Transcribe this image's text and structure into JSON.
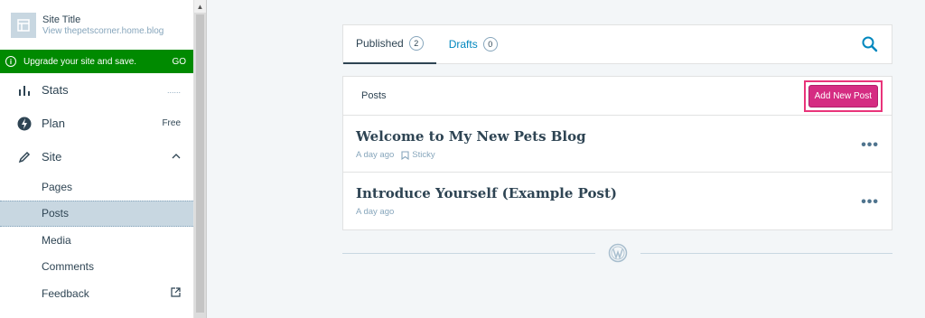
{
  "site": {
    "title": "Site Title",
    "url": "View thepetscorner.home.blog"
  },
  "upgrade": {
    "text": "Upgrade your site and save.",
    "cta": "GO",
    "color": "#008a00"
  },
  "nav": {
    "stats": {
      "label": "Stats",
      "extra": "......"
    },
    "plan": {
      "label": "Plan",
      "extra": "Free"
    },
    "site": {
      "label": "Site"
    }
  },
  "sub_items": [
    {
      "label": "Pages"
    },
    {
      "label": "Posts"
    },
    {
      "label": "Media"
    },
    {
      "label": "Comments"
    },
    {
      "label": "Feedback"
    }
  ],
  "tabs": [
    {
      "label": "Published",
      "count": "2"
    },
    {
      "label": "Drafts",
      "count": "0"
    }
  ],
  "posts_header": {
    "label": "Posts",
    "add_button": "Add New Post"
  },
  "posts": [
    {
      "title": "Welcome to My New Pets Blog",
      "date": "A day ago",
      "sticky": "Sticky"
    },
    {
      "title": "Introduce Yourself (Example Post)",
      "date": "A day ago"
    }
  ],
  "colors": {
    "accent": "#d52c82",
    "highlight": "#e9347a",
    "link": "#0087be"
  }
}
